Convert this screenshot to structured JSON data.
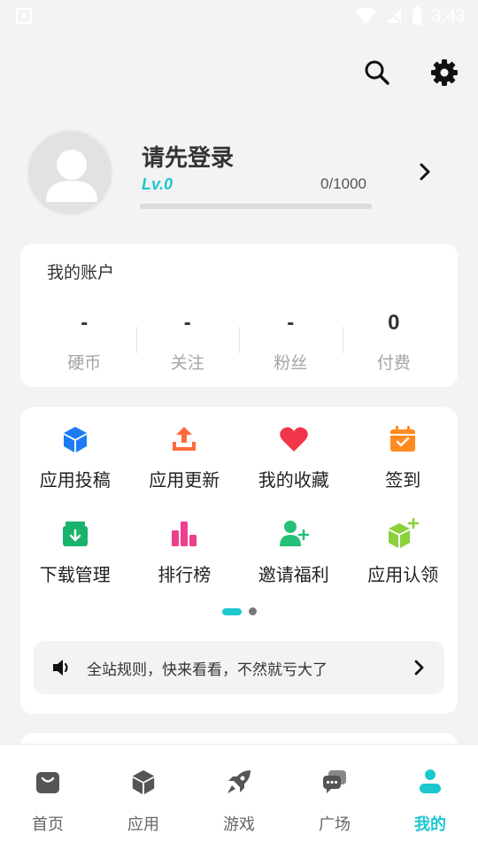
{
  "status_bar": {
    "left_icon": "A",
    "time": "3:43"
  },
  "profile": {
    "title": "请先登录",
    "level": "Lv.0",
    "exp": "0/1000",
    "exp_progress": 0
  },
  "account": {
    "title": "我的账户",
    "stats": [
      {
        "value": "-",
        "label": "硬币"
      },
      {
        "value": "-",
        "label": "关注"
      },
      {
        "value": "-",
        "label": "粉丝"
      },
      {
        "value": "0",
        "label": "付费"
      }
    ]
  },
  "features": [
    {
      "label": "应用投稿",
      "icon": "cube-icon",
      "color": "#1e7bf2"
    },
    {
      "label": "应用更新",
      "icon": "upload-icon",
      "color": "#ff6a3d"
    },
    {
      "label": "我的收藏",
      "icon": "heart-icon",
      "color": "#f2364a"
    },
    {
      "label": "签到",
      "icon": "calendar-check-icon",
      "color": "#ff8a1f"
    },
    {
      "label": "下载管理",
      "icon": "download-box-icon",
      "color": "#19b36b"
    },
    {
      "label": "排行榜",
      "icon": "bar-chart-icon",
      "color": "#ee3e8e"
    },
    {
      "label": "邀请福利",
      "icon": "add-user-icon",
      "color": "#25c178"
    },
    {
      "label": "应用认领",
      "icon": "claim-cube-icon",
      "color": "#8bd13a"
    }
  ],
  "pager": {
    "pages": 2,
    "active": 0
  },
  "notice": {
    "text": "全站规则，快来看看，不然就亏大了"
  },
  "bottom_nav": [
    {
      "label": "首页",
      "icon": "shopping-bag-icon"
    },
    {
      "label": "应用",
      "icon": "box-icon"
    },
    {
      "label": "游戏",
      "icon": "rocket-icon"
    },
    {
      "label": "广场",
      "icon": "chat-icon"
    },
    {
      "label": "我的",
      "icon": "person-icon",
      "active": true
    }
  ],
  "colors": {
    "accent": "#1cc7cf",
    "background": "#f3f3f3"
  }
}
